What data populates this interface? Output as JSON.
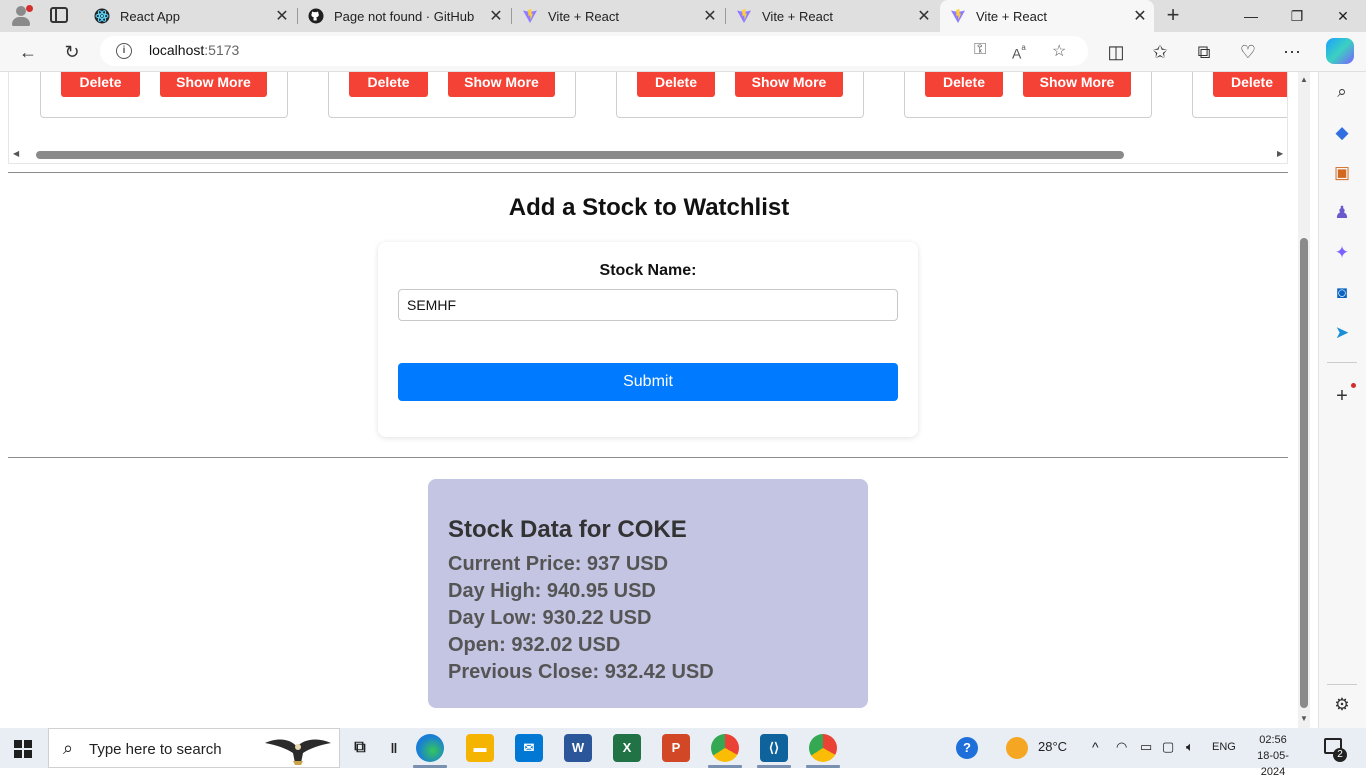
{
  "browser": {
    "tabs": [
      {
        "title": "React App"
      },
      {
        "title": "Page not found · GitHub"
      },
      {
        "title": "Vite + React"
      },
      {
        "title": "Vite + React"
      },
      {
        "title": "Vite + React"
      }
    ],
    "address": {
      "host": "localhost",
      "port": ":5173"
    }
  },
  "watchlist_cards": [
    {
      "delete_label": "Delete",
      "more_label": "Show More"
    },
    {
      "delete_label": "Delete",
      "more_label": "Show More"
    },
    {
      "delete_label": "Delete",
      "more_label": "Show More"
    },
    {
      "delete_label": "Delete",
      "more_label": "Show More"
    },
    {
      "delete_label": "Delete"
    }
  ],
  "form": {
    "heading": "Add a Stock to Watchlist",
    "stock_label": "Stock Name:",
    "stock_value": "SEMHF",
    "submit_label": "Submit"
  },
  "stock": {
    "heading": "Stock Data for COKE",
    "lines": [
      "Current Price: 937 USD",
      "Day High: 940.95 USD",
      "Day Low: 930.22 USD",
      "Open: 932.02 USD",
      "Previous Close: 932.42 USD"
    ]
  },
  "taskbar": {
    "search_placeholder": "Type here to search",
    "temperature": "28°C",
    "language": "ENG",
    "time": "02:56",
    "date": "18-05-2024",
    "notification_count": "2"
  },
  "colors": {
    "danger": "#f44336",
    "primary": "#007bff",
    "stock_card_bg": "#c4c5e3"
  }
}
